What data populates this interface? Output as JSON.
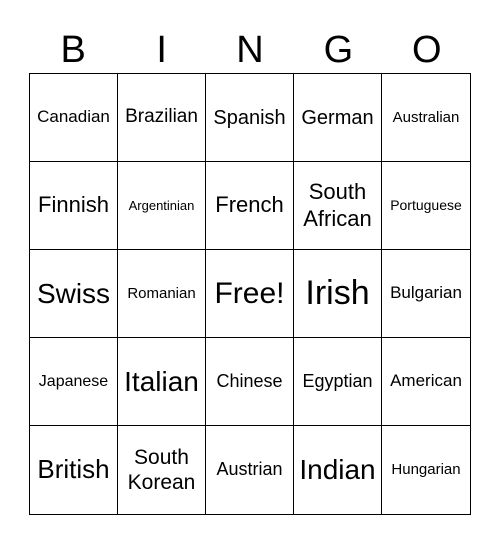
{
  "header": [
    "B",
    "I",
    "N",
    "G",
    "O"
  ],
  "cells": [
    "Canadian",
    "Brazilian",
    "Spanish",
    "German",
    "Australian",
    "Finnish",
    "Argentinian",
    "French",
    "South African",
    "Portuguese",
    "Swiss",
    "Romanian",
    "Free!",
    "Irish",
    "Bulgarian",
    "Japanese",
    "Italian",
    "Chinese",
    "Egyptian",
    "American",
    "British",
    "South Korean",
    "Austrian",
    "Indian",
    "Hungarian"
  ]
}
